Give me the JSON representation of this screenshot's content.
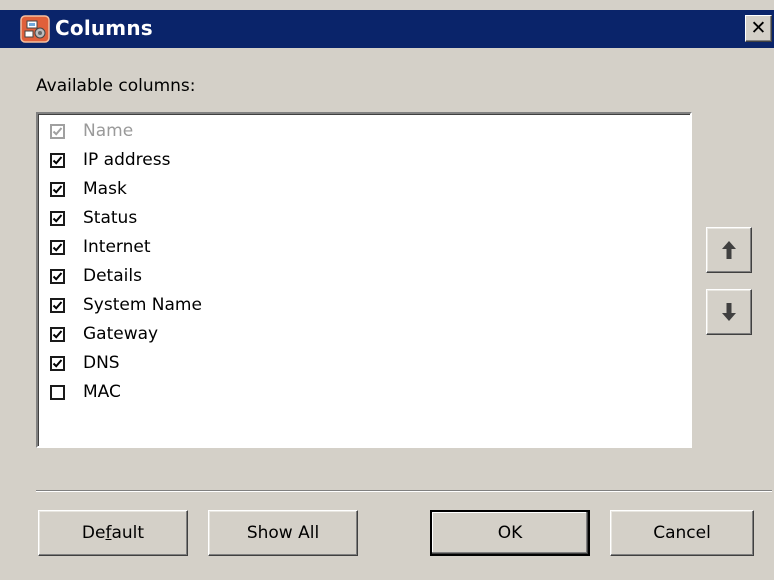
{
  "window": {
    "title": "Columns",
    "close_glyph": "✕",
    "title_icon": "app-network-icon",
    "colors": {
      "titlebar": "#0a246a",
      "face": "#d4d0c8"
    }
  },
  "list": {
    "label": "Available columns:",
    "items": [
      {
        "label": "Name",
        "checked": true,
        "disabled": true
      },
      {
        "label": "IP address",
        "checked": true,
        "disabled": false
      },
      {
        "label": "Mask",
        "checked": true,
        "disabled": false
      },
      {
        "label": "Status",
        "checked": true,
        "disabled": false
      },
      {
        "label": "Internet",
        "checked": true,
        "disabled": false
      },
      {
        "label": "Details",
        "checked": true,
        "disabled": false
      },
      {
        "label": "System Name",
        "checked": true,
        "disabled": false
      },
      {
        "label": "Gateway",
        "checked": true,
        "disabled": false
      },
      {
        "label": "DNS",
        "checked": true,
        "disabled": false
      },
      {
        "label": "MAC",
        "checked": false,
        "disabled": false
      }
    ]
  },
  "side_buttons": {
    "up_icon": "arrow-up-icon",
    "down_icon": "arrow-down-icon"
  },
  "buttons": {
    "default_pre": "De",
    "default_mnemonic": "f",
    "default_post": "ault",
    "show_all": "Show All",
    "ok": "OK",
    "cancel": "Cancel"
  }
}
